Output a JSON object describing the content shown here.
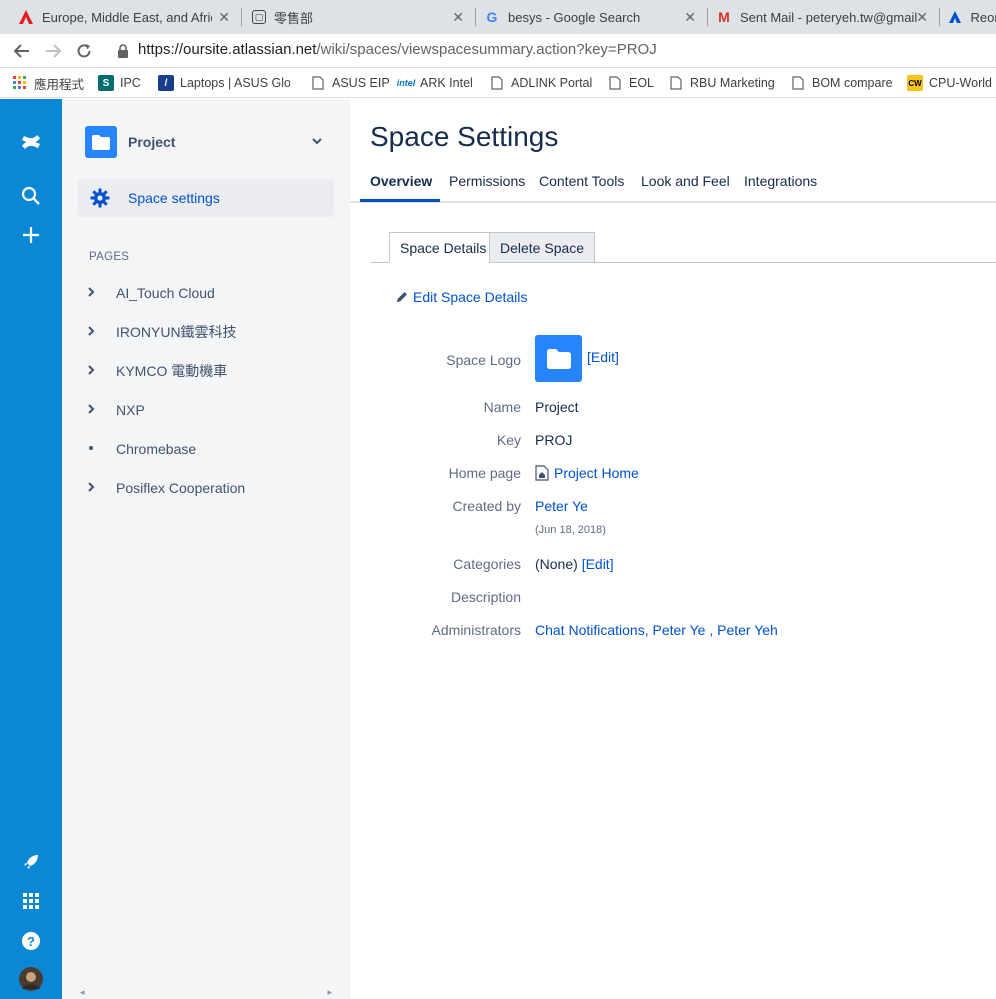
{
  "browser": {
    "tabs": [
      {
        "title": "Europe, Middle East, and Africa",
        "icon": "acrobat-icon",
        "color": "#e02020"
      },
      {
        "title": "零售部",
        "icon": "jira-icon",
        "color": "#444"
      },
      {
        "title": "besys - Google Search",
        "icon": "google-icon",
        "color": "#4285f4"
      },
      {
        "title": "Sent Mail - peteryeh.tw@gmail",
        "icon": "gmail-icon",
        "color": "#d93025"
      },
      {
        "title": "Reor",
        "icon": "atlassian-icon",
        "color": "#0052cc"
      }
    ],
    "url_host": "https://oursite.atlassian.net",
    "url_path": "/wiki/spaces/viewspacesummary.action?key=PROJ",
    "bookmarks": [
      {
        "label": "應用程式",
        "icon": "apps-grid-icon"
      },
      {
        "label": "IPC",
        "icon": "sharepoint-icon"
      },
      {
        "label": "Laptops | ASUS Glo",
        "icon": "asus-icon"
      },
      {
        "label": "ASUS EIP",
        "icon": "page-icon"
      },
      {
        "label": "ARK Intel",
        "icon": "intel-icon"
      },
      {
        "label": "ADLINK Portal",
        "icon": "page-icon"
      },
      {
        "label": "EOL",
        "icon": "page-icon"
      },
      {
        "label": "RBU Marketing",
        "icon": "page-icon"
      },
      {
        "label": "BOM compare",
        "icon": "page-icon"
      },
      {
        "label": "CPU-World",
        "icon": "cpuworld-icon"
      }
    ]
  },
  "sidebar": {
    "space_title": "Project",
    "space_settings_label": "Space settings",
    "pages_header": "PAGES",
    "pages": [
      {
        "label": "AI_Touch Cloud",
        "expandable": true
      },
      {
        "label": "IRONYUN鐵雲科技",
        "expandable": true
      },
      {
        "label": "KYMCO 電動機車",
        "expandable": true
      },
      {
        "label": "NXP",
        "expandable": true
      },
      {
        "label": "Chromebase",
        "expandable": false
      },
      {
        "label": "Posiflex Cooperation",
        "expandable": true
      }
    ]
  },
  "main": {
    "title": "Space Settings",
    "tabs": [
      "Overview",
      "Permissions",
      "Content Tools",
      "Look and Feel",
      "Integrations"
    ],
    "active_tab": "Overview",
    "subtabs": [
      "Space Details",
      "Delete Space"
    ],
    "edit_link": "Edit Space Details",
    "details": {
      "space_logo_label": "Space Logo",
      "logo_edit": "[Edit]",
      "name_label": "Name",
      "name": "Project",
      "key_label": "Key",
      "key": "PROJ",
      "home_label": "Home page",
      "home": "Project Home",
      "created_label": "Created by",
      "created_by": "Peter Ye",
      "created_date": "(Jun 18, 2018)",
      "categories_label": "Categories",
      "categories": "(None)",
      "categories_edit": "[Edit]",
      "description_label": "Description",
      "admins_label": "Administrators",
      "admins": [
        "Chat Notifications,",
        "Peter Ye ,",
        "Peter Yeh"
      ]
    }
  },
  "colors": {
    "brand": "#0a88d6",
    "link": "#0052cc",
    "logo": "#2684ff"
  }
}
